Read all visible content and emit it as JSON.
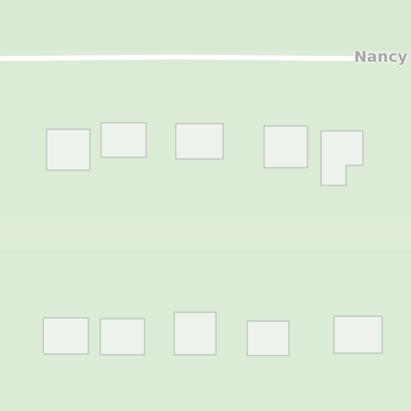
{
  "map": {
    "street_label": "Nancy",
    "colors": {
      "land": "#dcebd6",
      "road": "#ffffff",
      "building_fill": "#eef2ed",
      "building_stroke": "#a7b1a5",
      "label_text": "#a6a6a6",
      "label_halo": "#ffffff"
    }
  }
}
